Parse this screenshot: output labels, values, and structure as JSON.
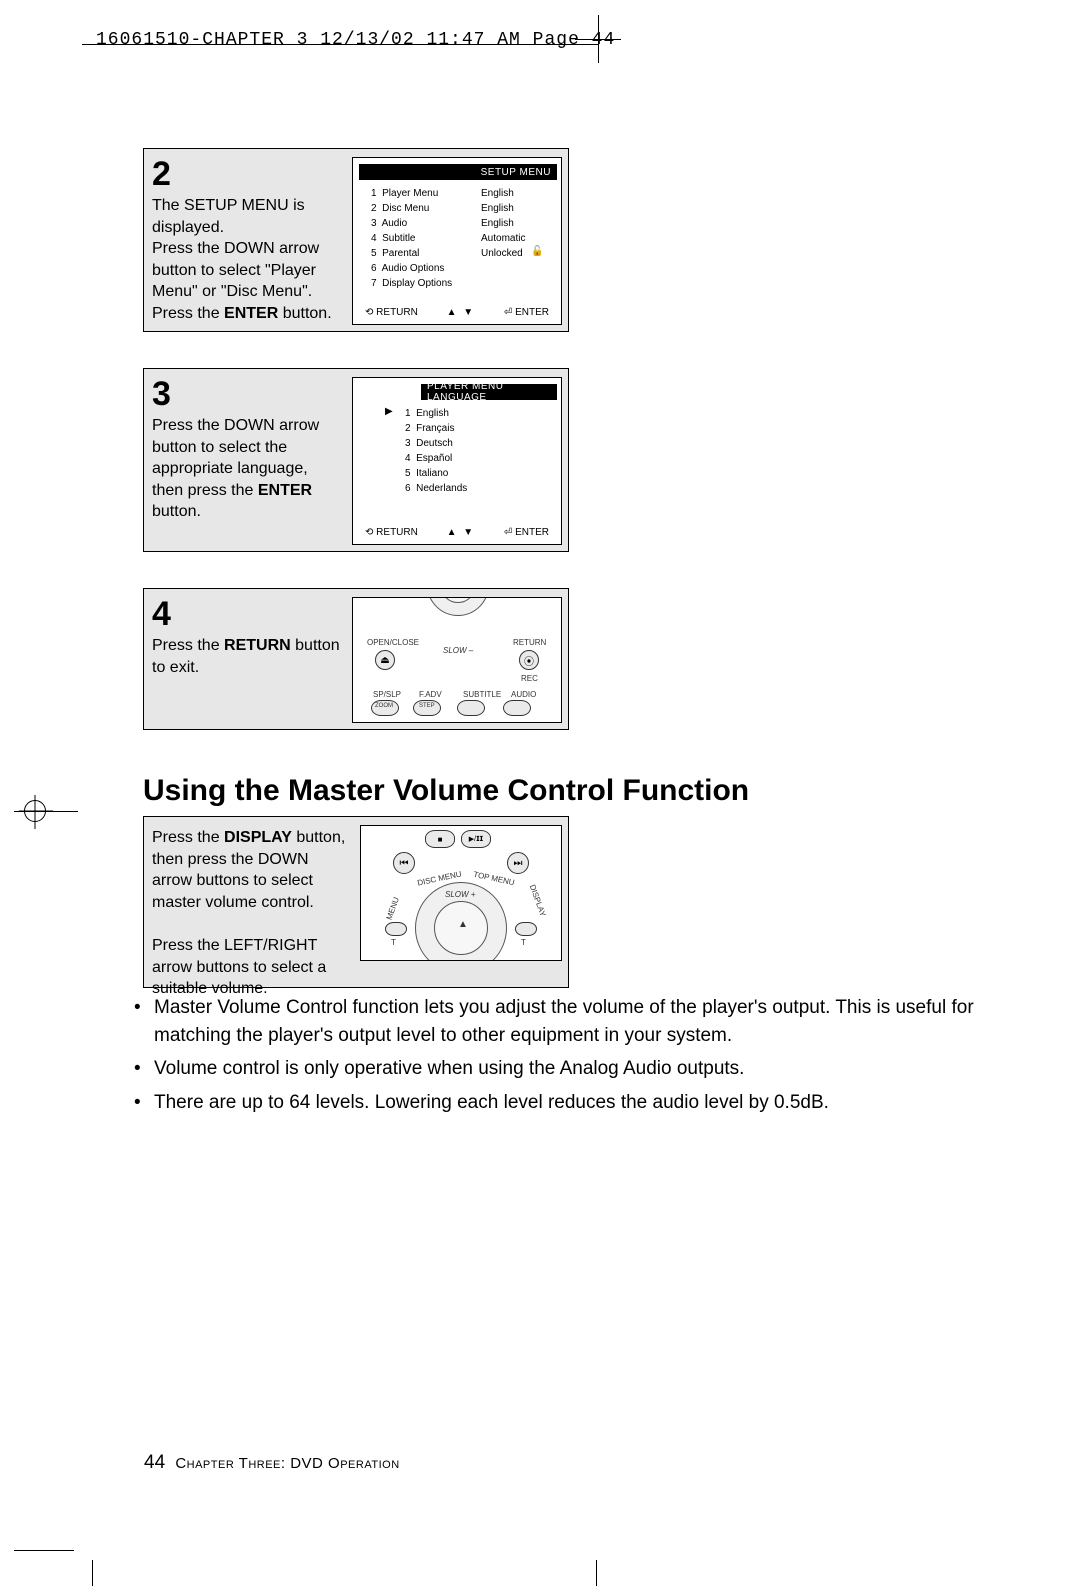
{
  "header": {
    "meta_line": "16061510-CHAPTER 3  12/13/02 11:47 AM  Page 44"
  },
  "step2": {
    "num": "2",
    "text_html": "The SETUP MENU is displayed.|Press the DOWN arrow button to select \"Player Menu\" or \"Disc Menu\".|Press the ENTER button.",
    "line1": "The SETUP MENU is displayed.",
    "line2": "Press the DOWN arrow button to select \"Player Menu\" or \"Disc Menu\".",
    "line3_pre": "Press the ",
    "line3_bold": "ENTER",
    "line3_post": " button."
  },
  "osd_setup": {
    "title": "SETUP  MENU",
    "col_left": "1  Player Menu\n2  Disc Menu\n3  Audio\n4  Subtitle\n5  Parental\n6  Audio Options\n7  Display Options",
    "col_right": "English\nEnglish\nEnglish\nAutomatic\nUnlocked",
    "return": "RETURN",
    "arrows": "▲ ▼",
    "enter": "ENTER",
    "lock": "🔓"
  },
  "step3": {
    "num": "3",
    "line1": "Press the DOWN arrow button to select the appropriate language, then press the ",
    "bold": "ENTER",
    "post": " button."
  },
  "osd_lang": {
    "title": "PLAYER MENU LANGUAGE",
    "cursor": "▶",
    "list": "1  English\n2  Français\n3  Deutsch\n4  Español\n5  Italiano\n6  Nederlands",
    "return": "RETURN",
    "arrows": "▲ ▼",
    "enter": "ENTER"
  },
  "step4": {
    "num": "4",
    "line_pre": "Press the ",
    "bold": "RETURN",
    "line_post": " button to exit."
  },
  "remote1": {
    "open": "OPEN/CLOSE",
    "return": "RETURN",
    "slow": "SLOW –",
    "rec": "REC",
    "row": {
      "a": "SP/SLP",
      "aa": "ZOOM",
      "b": "F.ADV",
      "bb": "STEP",
      "c": "SUBTITLE",
      "d": "AUDIO"
    }
  },
  "section_title": "Using the Master Volume Control Function",
  "vol_block": {
    "p1_pre": "Press the ",
    "p1_bold": "DISPLAY",
    "p1_post": " button, then press the DOWN arrow buttons to select master volume control.",
    "p2": "Press the LEFT/RIGHT arrow buttons to select a suitable volume."
  },
  "remote2": {
    "discmenu": "DISC MENU",
    "topmenu": "TOP MENU",
    "menulbl": "MENU",
    "display": "DISPLAY",
    "slow": "SLOW +",
    "stop": "■",
    "play": "▶/𝗜𝗜",
    "prev": "⏮",
    "next": "⏭",
    "up": "▲",
    "t": "T"
  },
  "bullets": {
    "b1": "Master Volume Control function lets you adjust the volume of the player's output. This is useful for matching the player's output level to other equipment in your system.",
    "b2": "Volume control is only operative when using the Analog Audio outputs.",
    "b3": "There are up to 64 levels. Lowering each level reduces the audio level by 0.5dB."
  },
  "footer": {
    "page": "44",
    "chapter": "Chapter Three: DVD Operation"
  }
}
